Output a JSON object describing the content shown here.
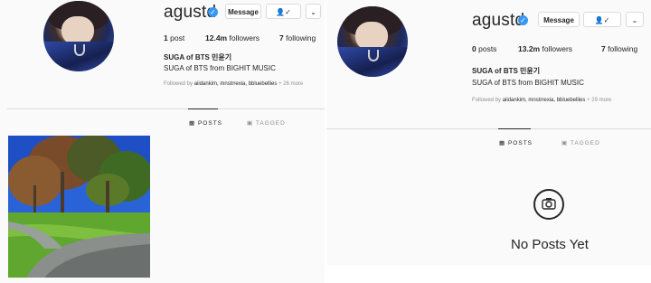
{
  "left": {
    "username": "agustd",
    "message_label": "Message",
    "follow_icon_label": "👤✓",
    "dropdown_label": "⌄",
    "stats": {
      "posts_num": "1",
      "posts_label": "post",
      "followers_num": "12.4m",
      "followers_label": "followers",
      "following_num": "7",
      "following_label": "following"
    },
    "name": "SUGA of BTS 민윤기",
    "bio": "SUGA of BTS from BIGHIT MUSIC",
    "followed_prefix": "Followed by ",
    "followed_names": "aiidankim, mnstrrexia, bbluebellies",
    "followed_suffix": " + 26 more",
    "tabs": {
      "posts": "POSTS",
      "tagged": "TAGGED"
    }
  },
  "right": {
    "username": "agustd",
    "message_label": "Message",
    "follow_icon_label": "👤✓",
    "dropdown_label": "⌄",
    "stats": {
      "posts_num": "0",
      "posts_label": "posts",
      "followers_num": "13.2m",
      "followers_label": "followers",
      "following_num": "7",
      "following_label": "following"
    },
    "name": "SUGA of BTS 민윤기",
    "bio": "SUGA of BTS from BIGHIT MUSIC",
    "followed_prefix": "Followed by ",
    "followed_names": "aiidankim, mnstrrexia, bbluebellies",
    "followed_suffix": " + 29 more",
    "tabs": {
      "posts": "POSTS",
      "tagged": "TAGGED"
    },
    "empty_state": "No Posts Yet"
  },
  "icons": [
    "verified-badge-icon",
    "person-check-icon",
    "chevron-down-icon",
    "grid-icon",
    "tag-icon",
    "camera-icon"
  ],
  "colors": {
    "verified": "#3897f0",
    "text": "#262626",
    "muted": "#8e8e8e",
    "border": "#dbdbdb",
    "bg": "#fafafa"
  }
}
